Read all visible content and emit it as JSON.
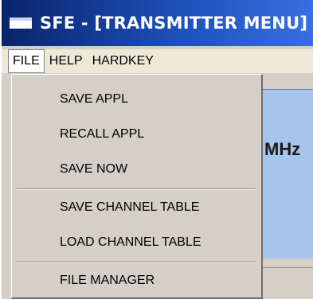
{
  "window": {
    "title": "SFE - [TRANSMITTER MENU]"
  },
  "menubar": {
    "items": [
      "FILE",
      "HELP",
      "HARDKEY"
    ]
  },
  "panel": {
    "unit_label": "MHz"
  },
  "file_menu": {
    "items": [
      "SAVE APPL",
      "RECALL APPL",
      "SAVE NOW",
      "SAVE CHANNEL TABLE",
      "LOAD CHANNEL TABLE",
      "FILE MANAGER"
    ]
  },
  "colors": {
    "titlebar": "#0a246a",
    "menu_background": "#d4d0c8",
    "panel_blue": "#a7c4ec"
  }
}
